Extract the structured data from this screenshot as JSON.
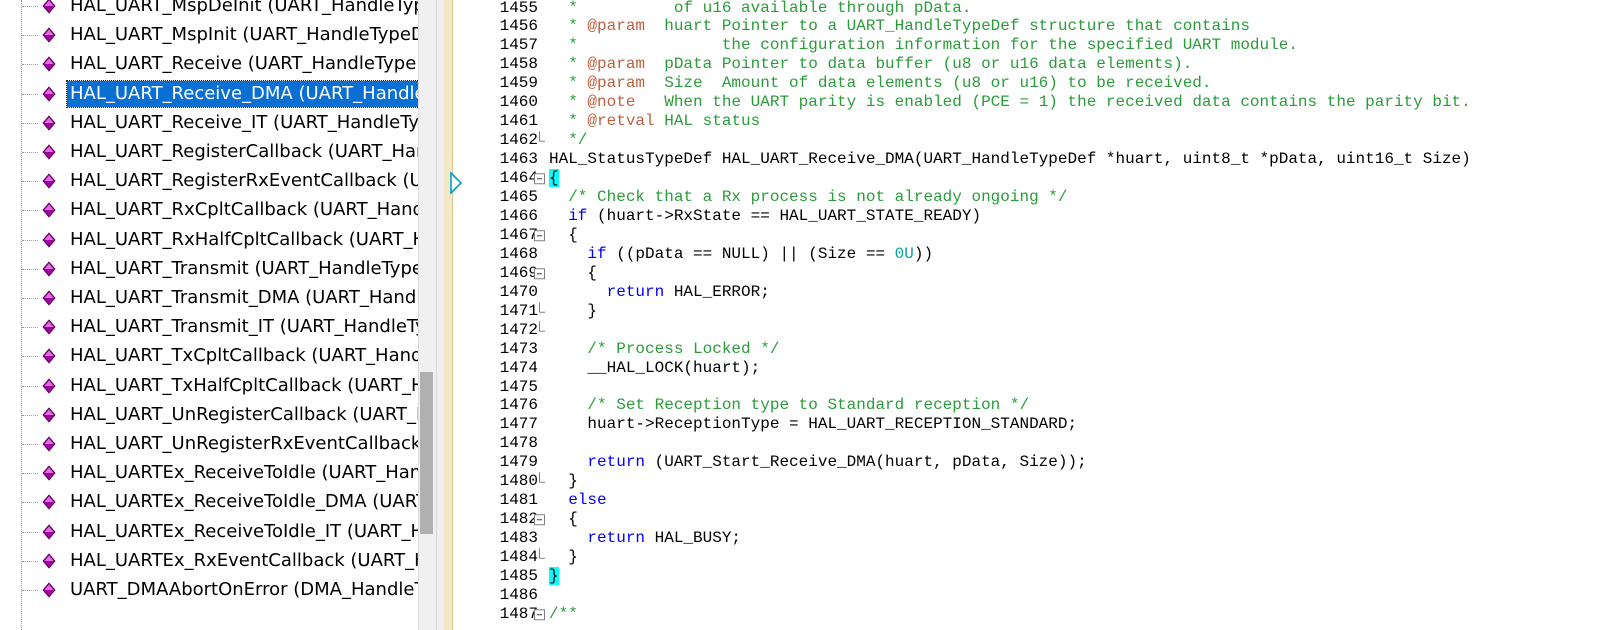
{
  "tree": {
    "items": [
      {
        "label": "HAL_UART_MspDeInit (UART_HandleTypeDef *huart)",
        "selected": false
      },
      {
        "label": "HAL_UART_MspInit (UART_HandleTypeDef *huart)",
        "selected": false
      },
      {
        "label": "HAL_UART_Receive (UART_HandleTypeDef *huart, ...)",
        "selected": false
      },
      {
        "label": "HAL_UART_Receive_DMA (UART_HandleTypeDef *huart, ...)",
        "selected": true
      },
      {
        "label": "HAL_UART_Receive_IT (UART_HandleTypeDef *huart, ...)",
        "selected": false
      },
      {
        "label": "HAL_UART_RegisterCallback (UART_HandleTypeDef *huart, ...)",
        "selected": false
      },
      {
        "label": "HAL_UART_RegisterRxEventCallback (UART_HandleTypeDef *huart, ...)",
        "selected": false
      },
      {
        "label": "HAL_UART_RxCpltCallback (UART_HandleTypeDef *huart)",
        "selected": false
      },
      {
        "label": "HAL_UART_RxHalfCpltCallback (UART_HandleTypeDef *huart)",
        "selected": false
      },
      {
        "label": "HAL_UART_Transmit (UART_HandleTypeDef *huart, ...)",
        "selected": false
      },
      {
        "label": "HAL_UART_Transmit_DMA (UART_HandleTypeDef *huart, ...)",
        "selected": false
      },
      {
        "label": "HAL_UART_Transmit_IT (UART_HandleTypeDef *huart, ...)",
        "selected": false
      },
      {
        "label": "HAL_UART_TxCpltCallback (UART_HandleTypeDef *huart)",
        "selected": false
      },
      {
        "label": "HAL_UART_TxHalfCpltCallback (UART_HandleTypeDef *huart)",
        "selected": false
      },
      {
        "label": "HAL_UART_UnRegisterCallback (UART_HandleTypeDef *huart, ...)",
        "selected": false
      },
      {
        "label": "HAL_UART_UnRegisterRxEventCallback (UART_HandleTypeDef *huart)",
        "selected": false
      },
      {
        "label": "HAL_UARTEx_ReceiveToIdle (UART_HandleTypeDef *huart, ...)",
        "selected": false
      },
      {
        "label": "HAL_UARTEx_ReceiveToIdle_DMA (UART_HandleTypeDef *huart, ...)",
        "selected": false
      },
      {
        "label": "HAL_UARTEx_ReceiveToIdle_IT (UART_HandleTypeDef *huart, ...)",
        "selected": false
      },
      {
        "label": "HAL_UARTEx_RxEventCallback (UART_HandleTypeDef *huart, ...)",
        "selected": false
      },
      {
        "label": "UART_DMAAbortOnError (DMA_HandleTypeDef *hdma)",
        "selected": false
      }
    ],
    "icon": "function-diamond-icon",
    "icon_color": "#a000a0"
  },
  "editor": {
    "current_line_marker": "execution-pointer-icon",
    "lines": [
      {
        "n": "1455",
        "fold": "",
        "segs": [
          [
            "c",
            "  *          of u16 available through pData."
          ]
        ]
      },
      {
        "n": "1456",
        "fold": "",
        "segs": [
          [
            "c",
            "  * "
          ],
          [
            "t",
            "@param"
          ],
          [
            "c",
            "  huart Pointer to a UART_HandleTypeDef structure that contains"
          ]
        ]
      },
      {
        "n": "1457",
        "fold": "",
        "segs": [
          [
            "c",
            "  *               the configuration information for the specified UART module."
          ]
        ]
      },
      {
        "n": "1458",
        "fold": "",
        "segs": [
          [
            "c",
            "  * "
          ],
          [
            "t",
            "@param"
          ],
          [
            "c",
            "  pData Pointer to data buffer (u8 or u16 data elements)."
          ]
        ]
      },
      {
        "n": "1459",
        "fold": "",
        "segs": [
          [
            "c",
            "  * "
          ],
          [
            "t",
            "@param"
          ],
          [
            "c",
            "  Size  Amount of data elements (u8 or u16) to be received."
          ]
        ]
      },
      {
        "n": "1460",
        "fold": "",
        "segs": [
          [
            "c",
            "  * "
          ],
          [
            "t",
            "@note"
          ],
          [
            "c",
            "   When the UART parity is enabled (PCE = 1) the received data contains the parity bit."
          ]
        ]
      },
      {
        "n": "1461",
        "fold": "",
        "segs": [
          [
            "c",
            "  * "
          ],
          [
            "t",
            "@retval"
          ],
          [
            "c",
            " HAL status"
          ]
        ]
      },
      {
        "n": "1462",
        "fold": "end",
        "segs": [
          [
            "c",
            "  */"
          ]
        ]
      },
      {
        "n": "1463",
        "fold": "",
        "segs": [
          [
            "p",
            "HAL_StatusTypeDef HAL_UART_Receive_DMA(UART_HandleTypeDef *huart, uint8_t *pData, uint16_t Size)"
          ]
        ]
      },
      {
        "n": "1464",
        "fold": "box",
        "segs": [
          [
            "h",
            "{"
          ]
        ]
      },
      {
        "n": "1465",
        "fold": "",
        "segs": [
          [
            "c",
            "  /* Check that a Rx process is not already ongoing */"
          ]
        ]
      },
      {
        "n": "1466",
        "fold": "",
        "segs": [
          [
            "p",
            "  "
          ],
          [
            "k",
            "if"
          ],
          [
            "p",
            " (huart->RxState == HAL_UART_STATE_READY)"
          ]
        ]
      },
      {
        "n": "1467",
        "fold": "box",
        "segs": [
          [
            "p",
            "  {"
          ]
        ]
      },
      {
        "n": "1468",
        "fold": "",
        "segs": [
          [
            "p",
            "    "
          ],
          [
            "k",
            "if"
          ],
          [
            "p",
            " ((pData == NULL) || (Size == "
          ],
          [
            "n",
            "0U"
          ],
          [
            "p",
            "))"
          ]
        ]
      },
      {
        "n": "1469",
        "fold": "box",
        "segs": [
          [
            "p",
            "    {"
          ]
        ]
      },
      {
        "n": "1470",
        "fold": "",
        "segs": [
          [
            "p",
            "      "
          ],
          [
            "k",
            "return"
          ],
          [
            "p",
            " HAL_ERROR;"
          ]
        ]
      },
      {
        "n": "1471",
        "fold": "end",
        "segs": [
          [
            "p",
            "    }"
          ]
        ]
      },
      {
        "n": "1472",
        "fold": "end",
        "segs": [
          [
            "p",
            ""
          ]
        ]
      },
      {
        "n": "1473",
        "fold": "",
        "segs": [
          [
            "c",
            "    /* Process Locked */"
          ]
        ]
      },
      {
        "n": "1474",
        "fold": "",
        "segs": [
          [
            "p",
            "    __HAL_LOCK(huart);"
          ]
        ]
      },
      {
        "n": "1475",
        "fold": "",
        "segs": [
          [
            "p",
            ""
          ]
        ]
      },
      {
        "n": "1476",
        "fold": "",
        "segs": [
          [
            "c",
            "    /* Set Reception type to Standard reception */"
          ]
        ]
      },
      {
        "n": "1477",
        "fold": "",
        "segs": [
          [
            "p",
            "    huart->ReceptionType = HAL_UART_RECEPTION_STANDARD;"
          ]
        ]
      },
      {
        "n": "1478",
        "fold": "",
        "segs": [
          [
            "p",
            ""
          ]
        ]
      },
      {
        "n": "1479",
        "fold": "",
        "segs": [
          [
            "p",
            "    "
          ],
          [
            "k",
            "return"
          ],
          [
            "p",
            " (UART_Start_Receive_DMA(huart, pData, Size));"
          ]
        ]
      },
      {
        "n": "1480",
        "fold": "end",
        "segs": [
          [
            "p",
            "  }"
          ]
        ]
      },
      {
        "n": "1481",
        "fold": "",
        "segs": [
          [
            "p",
            "  "
          ],
          [
            "k",
            "else"
          ]
        ]
      },
      {
        "n": "1482",
        "fold": "box",
        "segs": [
          [
            "p",
            "  {"
          ]
        ]
      },
      {
        "n": "1483",
        "fold": "",
        "segs": [
          [
            "p",
            "    "
          ],
          [
            "k",
            "return"
          ],
          [
            "p",
            " HAL_BUSY;"
          ]
        ]
      },
      {
        "n": "1484",
        "fold": "end",
        "segs": [
          [
            "p",
            "  }"
          ]
        ]
      },
      {
        "n": "1485",
        "fold": "",
        "segs": [
          [
            "h",
            "}"
          ]
        ]
      },
      {
        "n": "1486",
        "fold": "",
        "segs": [
          [
            "p",
            ""
          ]
        ]
      },
      {
        "n": "1487",
        "fold": "box",
        "segs": [
          [
            "c",
            "/**"
          ]
        ]
      }
    ]
  },
  "colors": {
    "selection": "#0a6fd3",
    "comment": "#2a9d3a",
    "keyword": "#0000ff",
    "number": "#0aa0a0",
    "brace_match": "#00ffff"
  }
}
